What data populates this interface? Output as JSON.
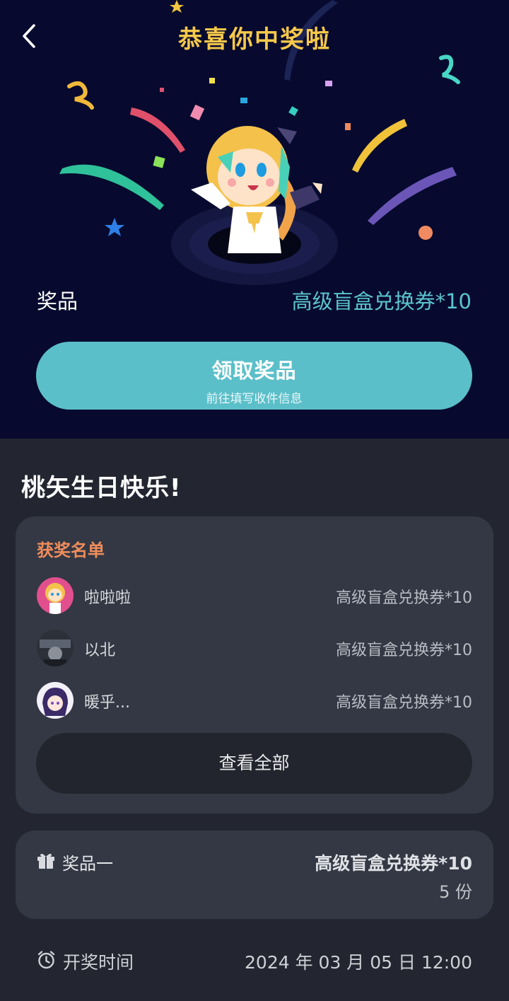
{
  "header": {
    "title": "恭喜你中奖啦"
  },
  "prize": {
    "label": "奖品",
    "value": "高级盲盒兑换券*10"
  },
  "claim": {
    "label": "领取奖品",
    "sublabel": "前往填写收件信息"
  },
  "event": {
    "title": "桃矢生日快乐!"
  },
  "winners": {
    "title": "获奖名单",
    "rows": [
      {
        "name": "啦啦啦",
        "prize": "高级盲盒兑换券*10"
      },
      {
        "name": "以北",
        "prize": "高级盲盒兑换券*10"
      },
      {
        "name": "暖乎...",
        "prize": "高级盲盒兑换券*10"
      }
    ],
    "view_all": "查看全部"
  },
  "prize_detail": {
    "icon": "gift-icon",
    "tier": "奖品一",
    "value": "高级盲盒兑换券*10",
    "quantity": "5 份"
  },
  "draw": {
    "icon": "alarm-clock-icon",
    "label": "开奖时间",
    "time": "2024 年 03 月 05 日 12:00"
  },
  "colors": {
    "hero_bg": "#070a2e",
    "page_bg": "#232630",
    "card_bg": "#343844",
    "accent_teal": "#5bbfc9",
    "title_gold": "#f7c84a",
    "winners_orange": "#ef8d5b"
  }
}
